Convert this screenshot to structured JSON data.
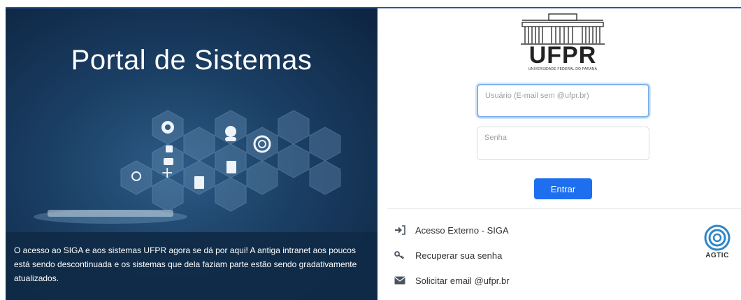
{
  "hero": {
    "title": "Portal de Sistemas",
    "description": "O acesso ao SIGA e aos sistemas UFPR agora se dá por aqui! A antiga intranet aos poucos está sendo descontinuada e os sistemas que dela faziam parte estão sendo gradativamente atualizados."
  },
  "logo": {
    "text": "UFPR",
    "subtitle": "UNIVERSIDADE FEDERAL DO PARANÁ"
  },
  "login": {
    "username_placeholder": "Usuário (E-mail sem @ufpr.br)",
    "password_placeholder": "Senha",
    "submit_label": "Entrar"
  },
  "links": [
    {
      "label": "Acesso Externo - SIGA",
      "icon": "sign-in-icon"
    },
    {
      "label": "Recuperar sua senha",
      "icon": "key-icon"
    },
    {
      "label": "Solicitar email @ufpr.br",
      "icon": "envelope-icon"
    }
  ],
  "footer_logo": {
    "text": "AGTIC"
  },
  "colors": {
    "accent": "#1e6ff0",
    "hero_dark": "#0d2340",
    "top_accent": "#1f5ea8",
    "icon_gray": "#4a5360"
  }
}
